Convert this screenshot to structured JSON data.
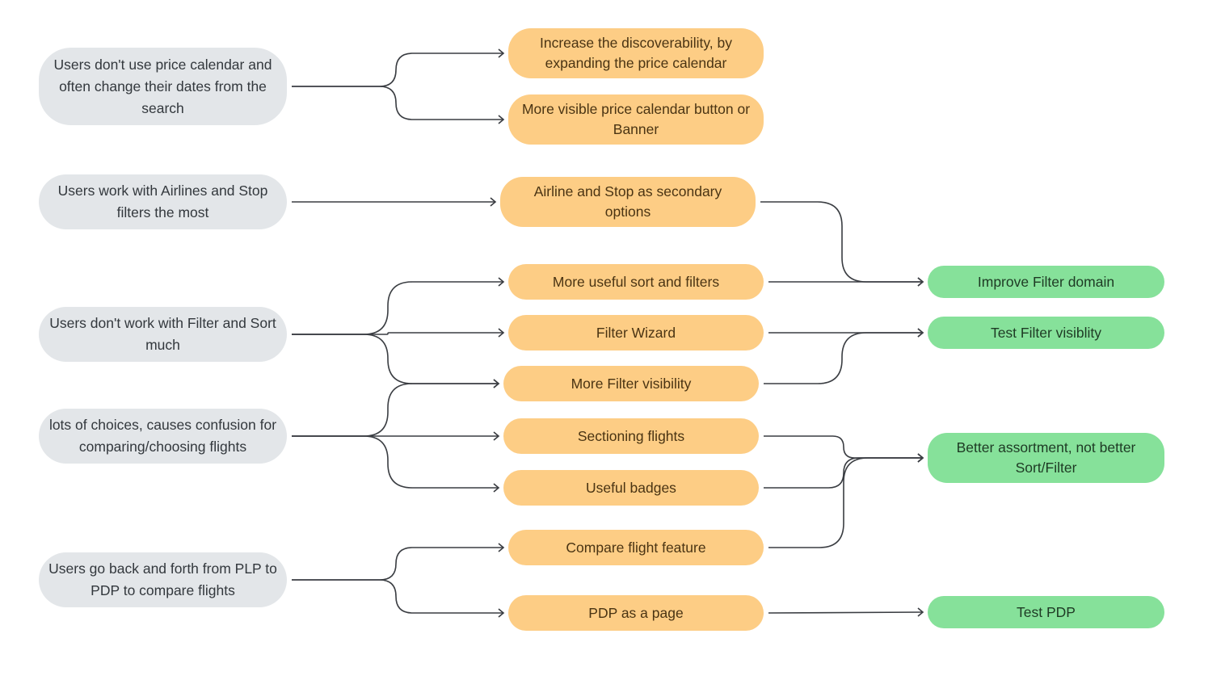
{
  "diagram": {
    "colors": {
      "problem_fill": "#e3e6e9",
      "idea_fill": "#fdcd85",
      "outcome_fill": "#86e19a",
      "connector": "#3a3d42"
    },
    "problems": [
      {
        "id": "p1",
        "label": "Users don't use price calendar and often change their dates from the search"
      },
      {
        "id": "p2",
        "label": "Users work with Airlines and Stop filters the most"
      },
      {
        "id": "p3",
        "label": "Users don't work with Filter and Sort much"
      },
      {
        "id": "p4",
        "label": "lots of choices, causes confusion for comparing/choosing flights"
      },
      {
        "id": "p5",
        "label": "Users go back and forth from PLP to PDP to compare flights"
      }
    ],
    "ideas": [
      {
        "id": "i1",
        "label": "Increase the discoverability, by expanding the price calendar"
      },
      {
        "id": "i2",
        "label": "More visible price calendar button or Banner"
      },
      {
        "id": "i3",
        "label": "Airline and Stop as secondary options"
      },
      {
        "id": "i4",
        "label": "More useful sort and filters"
      },
      {
        "id": "i5",
        "label": "Filter Wizard"
      },
      {
        "id": "i6",
        "label": "More Filter visibility"
      },
      {
        "id": "i7",
        "label": "Sectioning flights"
      },
      {
        "id": "i8",
        "label": "Useful badges"
      },
      {
        "id": "i9",
        "label": "Compare flight feature"
      },
      {
        "id": "i10",
        "label": "PDP as a page"
      }
    ],
    "outcomes": [
      {
        "id": "o1",
        "label": "Improve Filter domain"
      },
      {
        "id": "o2",
        "label": "Test Filter visiblity"
      },
      {
        "id": "o3",
        "label": "Better assortment, not better Sort/Filter"
      },
      {
        "id": "o4",
        "label": "Test PDP"
      }
    ],
    "edges": [
      {
        "from": "p1",
        "to": "i1"
      },
      {
        "from": "p1",
        "to": "i2"
      },
      {
        "from": "p2",
        "to": "i3"
      },
      {
        "from": "p3",
        "to": "i4"
      },
      {
        "from": "p3",
        "to": "i5"
      },
      {
        "from": "p3",
        "to": "i6"
      },
      {
        "from": "p4",
        "to": "i6"
      },
      {
        "from": "p4",
        "to": "i7"
      },
      {
        "from": "p4",
        "to": "i8"
      },
      {
        "from": "p5",
        "to": "i9"
      },
      {
        "from": "p5",
        "to": "i10"
      },
      {
        "from": "i3",
        "to": "o1"
      },
      {
        "from": "i4",
        "to": "o1"
      },
      {
        "from": "i5",
        "to": "o2"
      },
      {
        "from": "i6",
        "to": "o2"
      },
      {
        "from": "i7",
        "to": "o3"
      },
      {
        "from": "i8",
        "to": "o3"
      },
      {
        "from": "i9",
        "to": "o3"
      },
      {
        "from": "i10",
        "to": "o4"
      }
    ]
  }
}
